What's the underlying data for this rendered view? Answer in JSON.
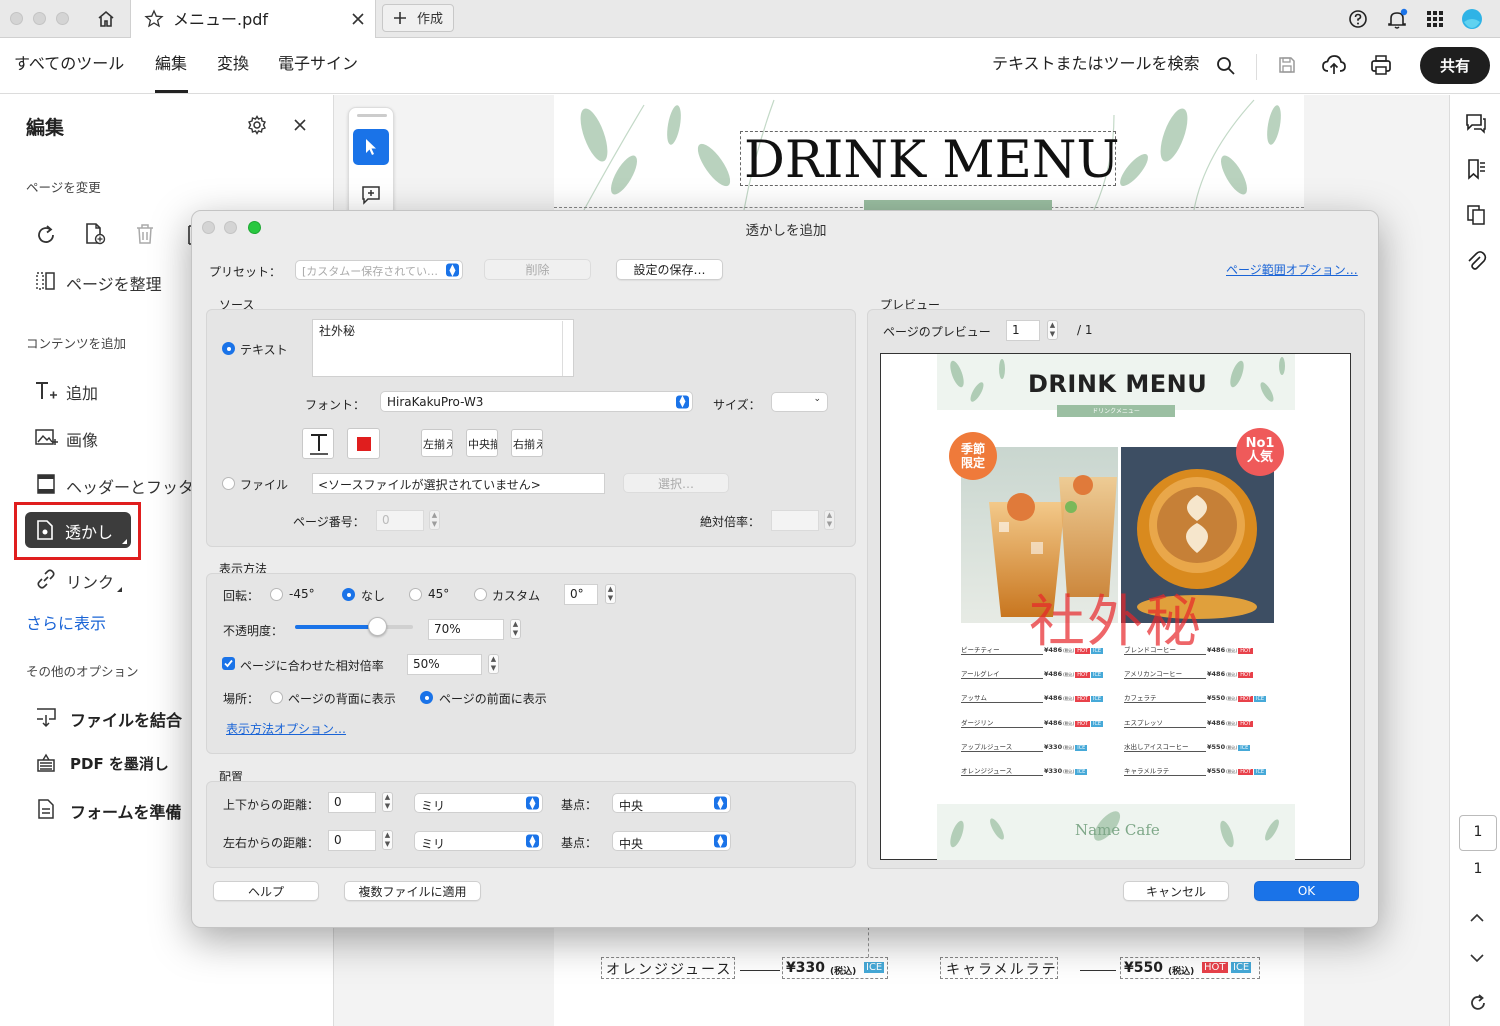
{
  "tabs": {
    "document_title": "メニュー.pdf",
    "new_tab_label": "作成"
  },
  "menu": {
    "items": [
      "すべてのツール",
      "編集",
      "変換",
      "電子サイン"
    ],
    "search_placeholder": "テキストまたはツールを検索",
    "share_label": "共有"
  },
  "left_panel": {
    "title": "編集",
    "section_change_page": "ページを変更",
    "organize_pages": "ページを整理",
    "section_add_content": "コンテンツを追加",
    "add_text": "追加",
    "add_image": "画像",
    "header_footer": "ヘッダーとフッタ",
    "watermark": "透かし",
    "link": "リンク",
    "show_more": "さらに表示",
    "section_other": "その他のオプション",
    "combine_files": "ファイルを結合",
    "redact_pdf": "PDF を墨消し",
    "prepare_form": "フォームを準備"
  },
  "document": {
    "title": "DRINK MENU",
    "bottom_rows": [
      {
        "name": "オレンジジュース",
        "price": "¥330",
        "tax": "(税込)",
        "badges": [
          "ICE"
        ]
      },
      {
        "name": "キャラメルラテ",
        "price": "¥550",
        "tax": "(税込)",
        "badges": [
          "HOT",
          "ICE"
        ]
      }
    ]
  },
  "dialog": {
    "title": "透かしを追加",
    "preset_label": "プリセット：",
    "preset_value": "[カスタムー保存されてい…",
    "delete_button": "削除",
    "save_settings_button": "設定の保存…",
    "page_range_link": "ページ範囲オプション…",
    "source_heading": "ソース",
    "text_radio": "テキスト",
    "text_value": "社外秘",
    "font_label": "フォント：",
    "font_value": "HiraKakuPro-W3",
    "size_label": "サイズ：",
    "align_left": "左揃え",
    "align_center": "中央揃え",
    "align_right": "右揃え",
    "file_radio": "ファイル",
    "file_value": "<ソースファイルが選択されていません>",
    "choose_button": "選択…",
    "page_number_label": "ページ番号：",
    "page_number_value": "0",
    "absolute_scale_label": "絶対倍率：",
    "appearance_heading": "表示方法",
    "rotation_label": "回転：",
    "rot_m45": "-45°",
    "rot_none": "なし",
    "rot_45": "45°",
    "rot_custom": "カスタム",
    "rot_custom_value": "0°",
    "opacity_label": "不透明度：",
    "opacity_value": "70%",
    "relative_scale_label": "ページに合わせた相対倍率",
    "relative_scale_value": "50%",
    "location_label": "場所：",
    "behind_page": "ページの背面に表示",
    "front_page": "ページの前面に表示",
    "appearance_options_link": "表示方法オプション…",
    "placement_heading": "配置",
    "vertical_distance_label": "上下からの距離：",
    "vertical_distance_value": "0",
    "horizontal_distance_label": "左右からの距離：",
    "horizontal_distance_value": "0",
    "unit_value": "ミリ",
    "anchor_label": "基点：",
    "anchor_value": "中央",
    "preview_heading": "プレビュー",
    "page_preview_label": "ページのプレビュー",
    "page_preview_value": "1",
    "page_total": "/ 1",
    "help_button": "ヘルプ",
    "apply_multiple_button": "複数ファイルに適用",
    "cancel_button": "キャンセル",
    "ok_button": "OK",
    "opacity_fraction": 0.7,
    "relative_scale_checked": true
  },
  "preview": {
    "title": "DRINK MENU",
    "subtitle": "ドリンクメニュー",
    "badge_left": "季節\n限定",
    "badge_right": "No1\n人気",
    "watermark_text": "社外秘",
    "footer": "Name Cafe",
    "menu_left": [
      {
        "name": "ピーチティー",
        "price": "¥486",
        "tags": [
          "HOT",
          "ICE"
        ]
      },
      {
        "name": "アールグレイ",
        "price": "¥486",
        "tags": [
          "HOT",
          "ICE"
        ]
      },
      {
        "name": "アッサム",
        "price": "¥486",
        "tags": [
          "HOT",
          "ICE"
        ]
      },
      {
        "name": "ダージリン",
        "price": "¥486",
        "tags": [
          "HOT",
          "ICE"
        ]
      },
      {
        "name": "アップルジュース",
        "price": "¥330",
        "tags": [
          "ICE"
        ]
      },
      {
        "name": "オレンジジュース",
        "price": "¥330",
        "tags": [
          "ICE"
        ]
      }
    ],
    "menu_right": [
      {
        "name": "ブレンドコーヒー",
        "price": "¥486",
        "tags": [
          "HOT"
        ]
      },
      {
        "name": "アメリカンコーヒー",
        "price": "¥486",
        "tags": [
          "HOT"
        ]
      },
      {
        "name": "カフェラテ",
        "price": "¥550",
        "tags": [
          "HOT",
          "ICE"
        ]
      },
      {
        "name": "エスプレッソ",
        "price": "¥486",
        "tags": [
          "HOT"
        ]
      },
      {
        "name": "水出しアイスコーヒー",
        "price": "¥550",
        "tags": [
          "ICE"
        ]
      },
      {
        "name": "キャラメルラテ",
        "price": "¥550",
        "tags": [
          "HOT",
          "ICE"
        ]
      }
    ],
    "tax_label": "(税込)"
  },
  "right_rail": {
    "page_current": "1",
    "page_total": "1"
  },
  "colors": {
    "accent": "#1a73e8",
    "highlight_red": "#e01e1e",
    "watermark_red": "#e8262a",
    "leaf_green": "#9bbfa2",
    "hot_tag": "#e8414a",
    "ice_tag": "#46a9d8"
  }
}
